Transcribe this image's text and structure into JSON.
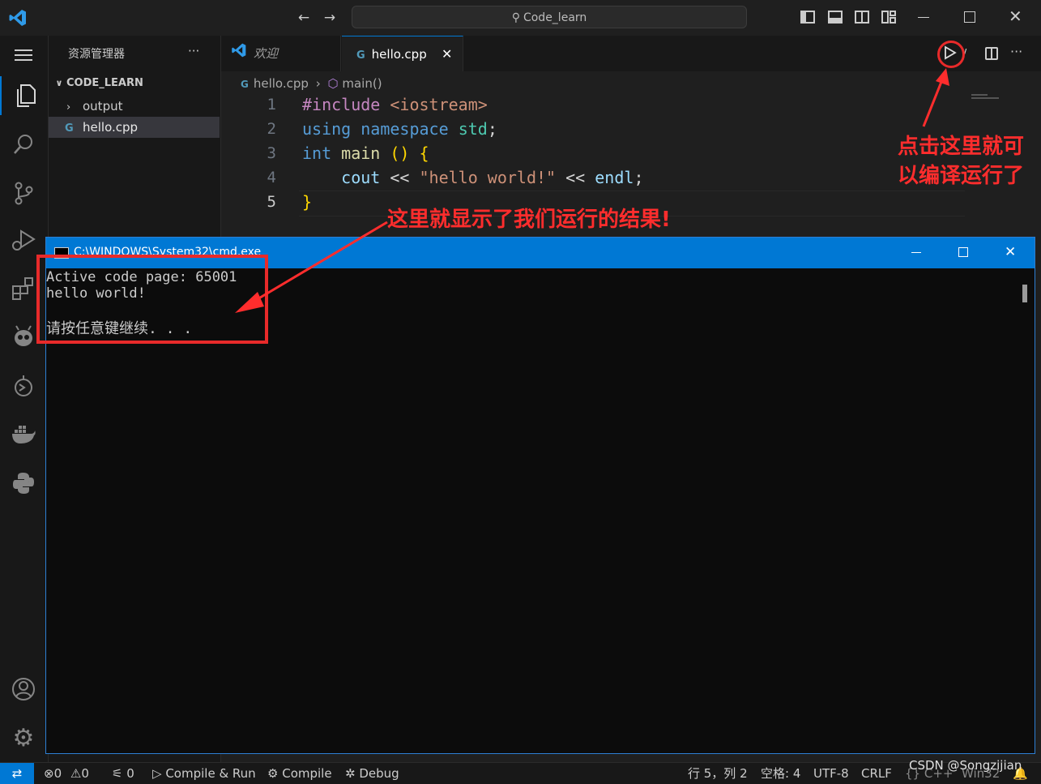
{
  "titlebar": {
    "search": "Code_learn"
  },
  "sidebar": {
    "title": "资源管理器",
    "more": "···",
    "section": "CODE_LEARN",
    "items": [
      {
        "label": "output",
        "type": "folder"
      },
      {
        "label": "hello.cpp",
        "type": "file"
      }
    ]
  },
  "tabs": [
    {
      "label": "欢迎",
      "active": false
    },
    {
      "label": "hello.cpp",
      "active": true
    }
  ],
  "breadcrumb": {
    "file": "hello.cpp",
    "symbol": "main()"
  },
  "code": {
    "line_numbers": [
      "1",
      "2",
      "3",
      "4",
      "5"
    ],
    "lines": [
      "#include <iostream>",
      "using namespace std;",
      "int main () {",
      "    cout << \"hello world!\" << endl;",
      "}"
    ]
  },
  "cmd": {
    "title": "C:\\WINDOWS\\System32\\cmd.exe",
    "lines": [
      "Active code page: 65001",
      "hello world!",
      "",
      "请按任意键继续. . ."
    ]
  },
  "annotations": {
    "run_note_line1": "点击这里就可",
    "run_note_line2": "以编译运行了",
    "result_note": "这里就显示了我们运行的结果!"
  },
  "statusbar": {
    "errors": "0",
    "warnings": "0",
    "ports": "0",
    "compile_run": "Compile & Run",
    "compile": "Compile",
    "debug": "Debug",
    "position": "行 5，列 2",
    "spaces": "空格: 4",
    "encoding": "UTF-8",
    "eol": "CRLF",
    "language": "C++",
    "platform": "Win32",
    "watermark": "CSDN @Songzijian"
  },
  "colors": {
    "accent": "#0078d4",
    "annotation": "#ff2d2d",
    "keyword": "#569cd6",
    "preproc": "#c586c0",
    "string": "#ce9178",
    "ident": "#9cdcfe",
    "type": "#4ec9b0"
  }
}
